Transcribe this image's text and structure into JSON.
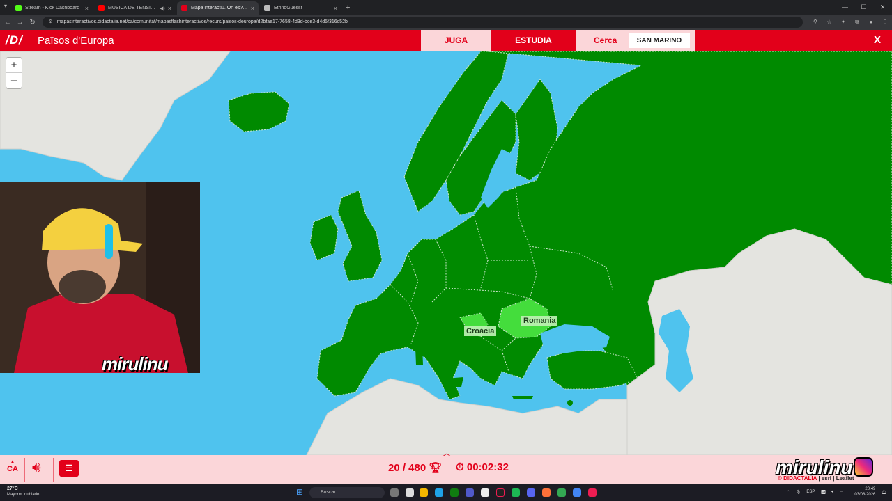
{
  "browser": {
    "tabs": [
      {
        "label": "Stream - Kick Dashboard",
        "color": "#53fc18",
        "active": false
      },
      {
        "label": "MÚSICA DE TENSIÓ D''EL",
        "color": "#ff0000",
        "active": false
      },
      {
        "label": "Mapa interactiu. On és? Països",
        "color": "#e2001a",
        "active": true
      },
      {
        "label": "EthnoGuessr",
        "color": "#bbbbbb",
        "active": false
      }
    ],
    "url": "mapasinteractivos.didactalia.net/ca/comunitat/mapasflashinteractivos/recurs/paisos-deuropa/d2bfae17-7658-4d3d-bce3-d4d5f316c52b"
  },
  "app": {
    "logo": "/D/",
    "title": "Països d'Europa",
    "juga": "JUGA",
    "estudia": "ESTUDIA",
    "cerca_label": "Cerca",
    "target_country": "SAN MARINO",
    "close": "X",
    "accent": "#e2001a"
  },
  "map": {
    "zoom_in": "+",
    "zoom_out": "–",
    "labels": [
      "Romania",
      "Croàcia"
    ],
    "found_color": "#008a00",
    "highlight_color": "#44dd3c",
    "sea_color": "#4fc3ee",
    "land_color": "#e4e4e0"
  },
  "overlay": {
    "streamer": "mirulinu",
    "attribution_left": "© DIDACTALIA",
    "attribution_right": "esri",
    "leaflet": "Leaflet"
  },
  "bottom": {
    "lang": "CA",
    "score": "20 / 480",
    "timer": "00:02:32"
  },
  "taskbar": {
    "temperature": "27°C",
    "weather": "Mayorm. nublado",
    "search": "Buscar",
    "lang": "ESP",
    "time": "20:49",
    "date": "03/08/2026"
  }
}
